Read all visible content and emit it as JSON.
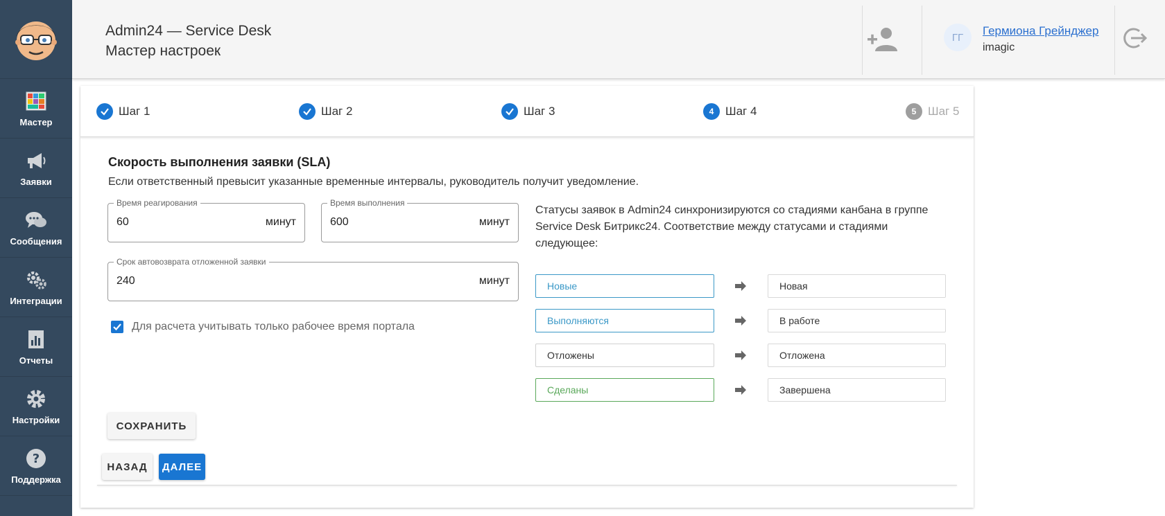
{
  "sidebar": {
    "items": [
      {
        "label": "Мастер",
        "icon": "master-tiles-icon"
      },
      {
        "label": "Заявки",
        "icon": "megaphone-icon"
      },
      {
        "label": "Сообщения",
        "icon": "chat-bubbles-icon"
      },
      {
        "label": "Интеграции",
        "icon": "puzzle-gears-icon"
      },
      {
        "label": "Отчеты",
        "icon": "report-chart-icon"
      },
      {
        "label": "Настройки",
        "icon": "gear-icon"
      },
      {
        "label": "Поддержка",
        "icon": "question-icon"
      }
    ]
  },
  "header": {
    "title": "Admin24 — Service Desk",
    "subtitle": "Мастер настроек",
    "avatar_initials": "ГГ",
    "user_name": "Гермиона Грейнджер",
    "user_login": "imagic"
  },
  "stepper": {
    "steps": [
      {
        "label": "Шаг 1",
        "state": "done"
      },
      {
        "label": "Шаг 2",
        "state": "done"
      },
      {
        "label": "Шаг 3",
        "state": "done"
      },
      {
        "label": "Шаг 4",
        "state": "active",
        "number": "4"
      },
      {
        "label": "Шаг 5",
        "state": "future",
        "number": "5"
      }
    ]
  },
  "sla": {
    "title": "Скорость выполнения заявки (SLA)",
    "description": "Если ответственный превысит указанные временные интервалы, руководитель получит уведомление.",
    "reaction": {
      "label": "Время реагирования",
      "value": "60",
      "unit": "минут"
    },
    "execution": {
      "label": "Время выполнения",
      "value": "600",
      "unit": "минут"
    },
    "autoreturn": {
      "label": "Срок автовозврата отложенной заявки",
      "value": "240",
      "unit": "минут"
    },
    "workhours_checkbox": {
      "label": "Для расчета учитывать только рабочее время портала",
      "checked": true
    }
  },
  "status_mapping": {
    "info": "Статусы заявок в Admin24 синхронизируются со стадиями канбана в группе Service Desk Битрикс24. Соответствие между статусами и стадиями следующее:",
    "rows": [
      {
        "status": "Новые",
        "stage": "Новая",
        "color": "#3a98c7"
      },
      {
        "status": "Выполняются",
        "stage": "В работе",
        "color": "#3a98c7"
      },
      {
        "status": "Отложены",
        "stage": "Отложена",
        "color": "#333333"
      },
      {
        "status": "Сделаны",
        "stage": "Завершена",
        "color": "#5aa85a"
      }
    ]
  },
  "buttons": {
    "save": "СОХРАНИТЬ",
    "back": "НАЗАД",
    "next": "ДАЛЕЕ"
  },
  "colors": {
    "sidebar_bg": "#34495e",
    "accent": "#1976d2",
    "link": "#2a6fcf"
  }
}
